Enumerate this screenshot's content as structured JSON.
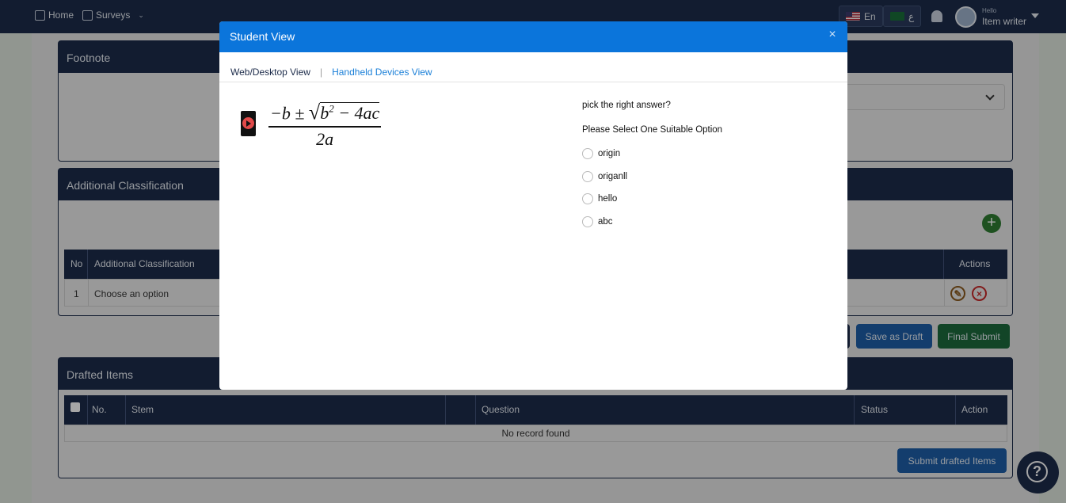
{
  "nav": {
    "home": "Home",
    "surveys": "Surveys",
    "lang_en": "En",
    "lang_ar": "ع",
    "hello": "Hello",
    "username": "Item writer"
  },
  "footnote": {
    "title": "Footnote"
  },
  "classification": {
    "title": "Additional Classification",
    "headers": [
      "No",
      "Additional Classification",
      "Actions"
    ],
    "row": {
      "no": "1",
      "value": "Choose an option"
    }
  },
  "buttons": {
    "save_draft": "Save as Draft",
    "final_submit": "Final Submit",
    "submit_drafted": "Submit drafted Items"
  },
  "drafted": {
    "title": "Drafted Items",
    "headers": [
      "No.",
      "Stem",
      "Question",
      "Status",
      "Action"
    ],
    "empty": "No record found"
  },
  "help": "?",
  "modal": {
    "title": "Student View",
    "close": "×",
    "tab_desktop": "Web/Desktop View",
    "tab_sep": "|",
    "tab_handheld": "Handheld Devices View",
    "formula": {
      "numerator_pre": "−b ± ",
      "radicand": "b",
      "exp": "2",
      "radicand_post": " − 4ac",
      "denominator": "2a"
    },
    "question": "pick the right answer?",
    "instruction": "Please Select One Suitable Option",
    "options": [
      "origin",
      "origanll",
      "hello",
      "abc"
    ]
  }
}
